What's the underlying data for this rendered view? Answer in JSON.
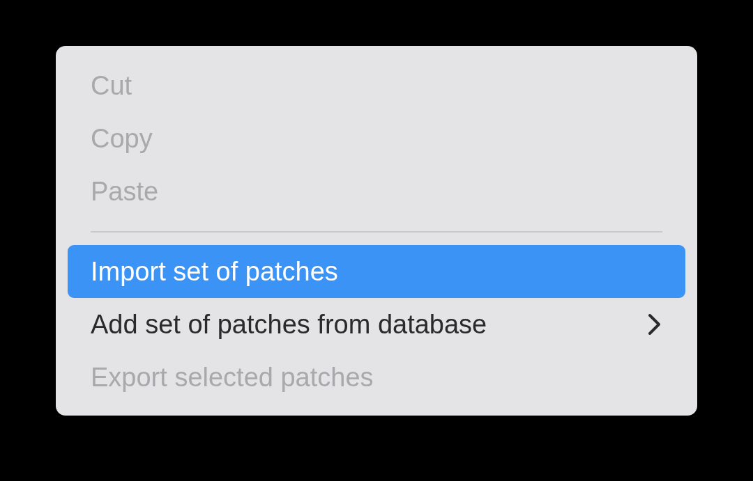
{
  "menu": {
    "items": [
      {
        "kind": "item",
        "label": "Cut",
        "disabled": true,
        "selected": false,
        "submenu": false
      },
      {
        "kind": "item",
        "label": "Copy",
        "disabled": true,
        "selected": false,
        "submenu": false
      },
      {
        "kind": "item",
        "label": "Paste",
        "disabled": true,
        "selected": false,
        "submenu": false
      },
      {
        "kind": "separator"
      },
      {
        "kind": "item",
        "label": "Import set of patches",
        "disabled": false,
        "selected": true,
        "submenu": false
      },
      {
        "kind": "item",
        "label": "Add set of patches from database",
        "disabled": false,
        "selected": false,
        "submenu": true
      },
      {
        "kind": "item",
        "label": "Export selected patches",
        "disabled": true,
        "selected": false,
        "submenu": false
      }
    ]
  }
}
